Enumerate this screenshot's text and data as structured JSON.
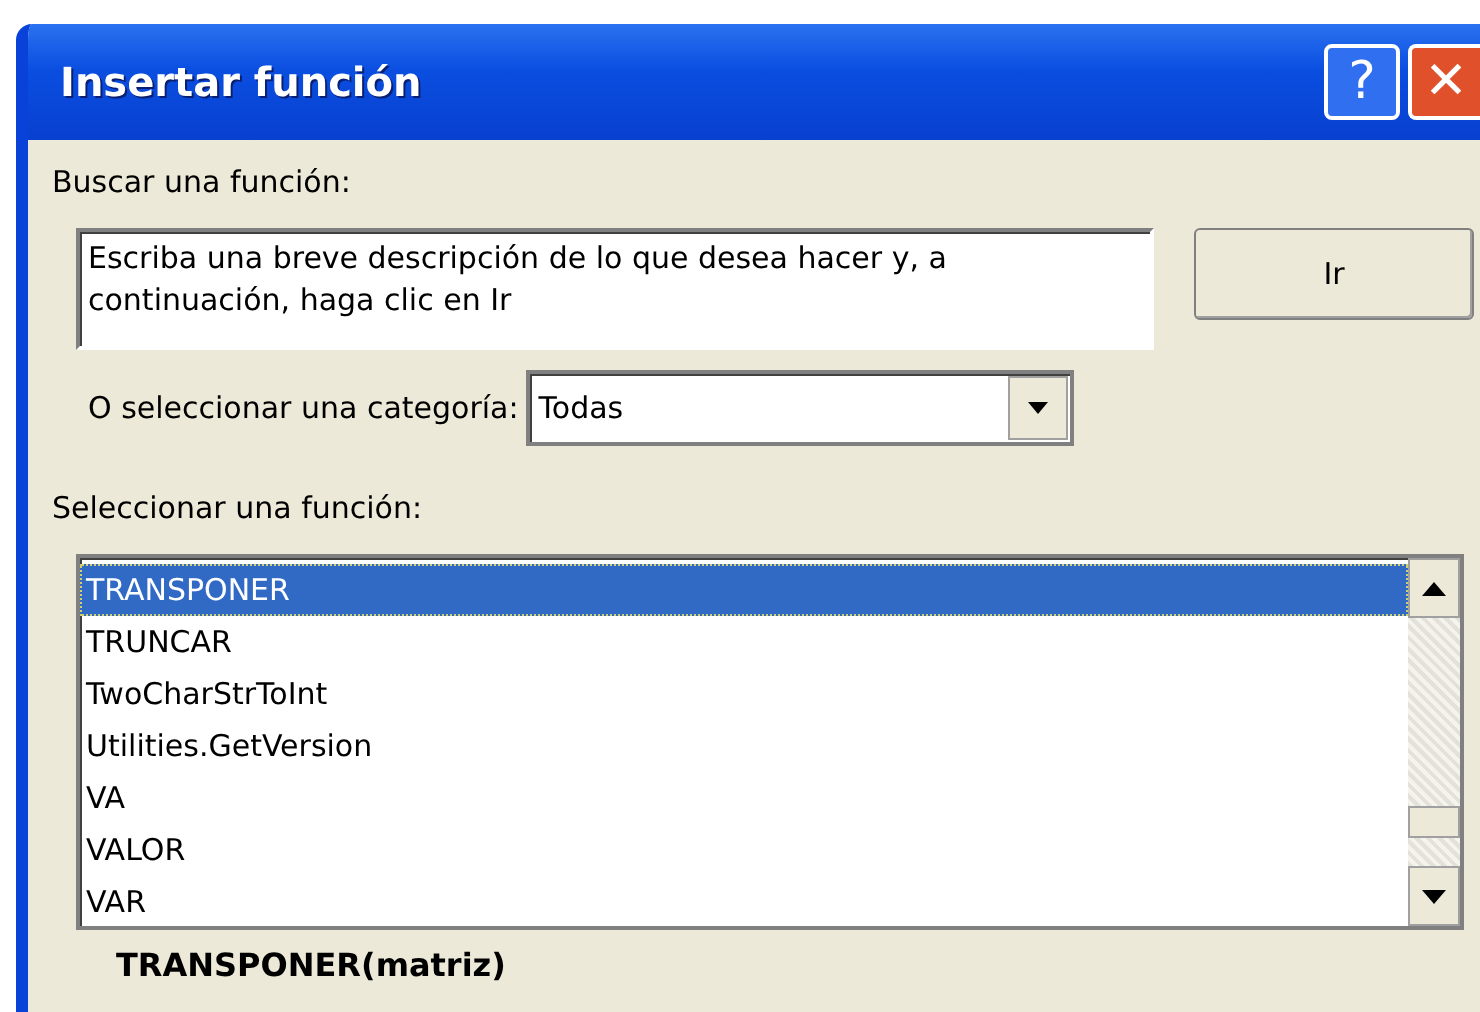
{
  "window": {
    "title": "Insertar función",
    "buttons": [
      {
        "kind": "help",
        "label": "?"
      },
      {
        "kind": "close",
        "label": "✕"
      }
    ]
  },
  "search": {
    "label": "Buscar una función:",
    "placeholder": "Escriba una breve descripción de lo que desea hacer y, a continuación, haga clic en Ir",
    "button": "Ir"
  },
  "category": {
    "label": "O seleccionar una categoría:",
    "value": "Todas"
  },
  "functions": {
    "label": "Seleccionar una función:",
    "items": [
      {
        "name": "TRANSPONER",
        "selected": true
      },
      {
        "name": "TRUNCAR",
        "selected": false
      },
      {
        "name": "TwoCharStrToInt",
        "selected": false
      },
      {
        "name": "Utilities.GetVersion",
        "selected": false
      },
      {
        "name": "VA",
        "selected": false
      },
      {
        "name": "VALOR",
        "selected": false
      },
      {
        "name": "VAR",
        "selected": false
      }
    ]
  },
  "signature": "TRANSPONER(matriz)"
}
